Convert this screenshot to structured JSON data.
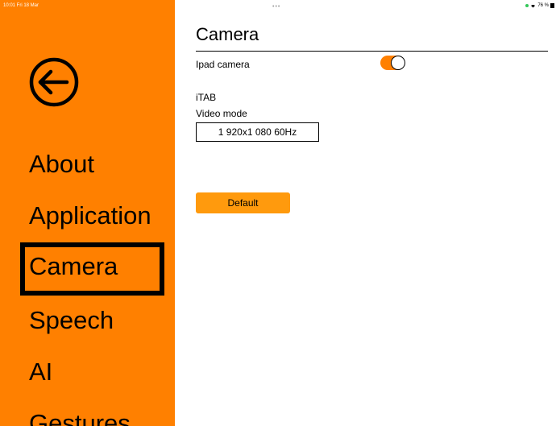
{
  "status_bar": {
    "time": "10:01  Fri 18 Mar",
    "dots": "•••",
    "battery": "76 %"
  },
  "colors": {
    "accent": "#ff8000",
    "button": "#ff9a0d",
    "wifi_dot": "#34c759"
  },
  "sidebar": {
    "back_icon": "arrow-left-circle-icon",
    "items": [
      {
        "label": "About"
      },
      {
        "label": "Application"
      },
      {
        "label": "Camera",
        "selected": true
      },
      {
        "label": "Speech"
      },
      {
        "label": "AI"
      },
      {
        "label": "Gestures"
      }
    ]
  },
  "main": {
    "title": "Camera",
    "ipad_camera": {
      "label": "Ipad camera",
      "enabled": true
    },
    "itab_label": "iTAB",
    "video_mode": {
      "label": "Video mode",
      "value": "1 920x1 080 60Hz"
    },
    "default_button": "Default"
  }
}
